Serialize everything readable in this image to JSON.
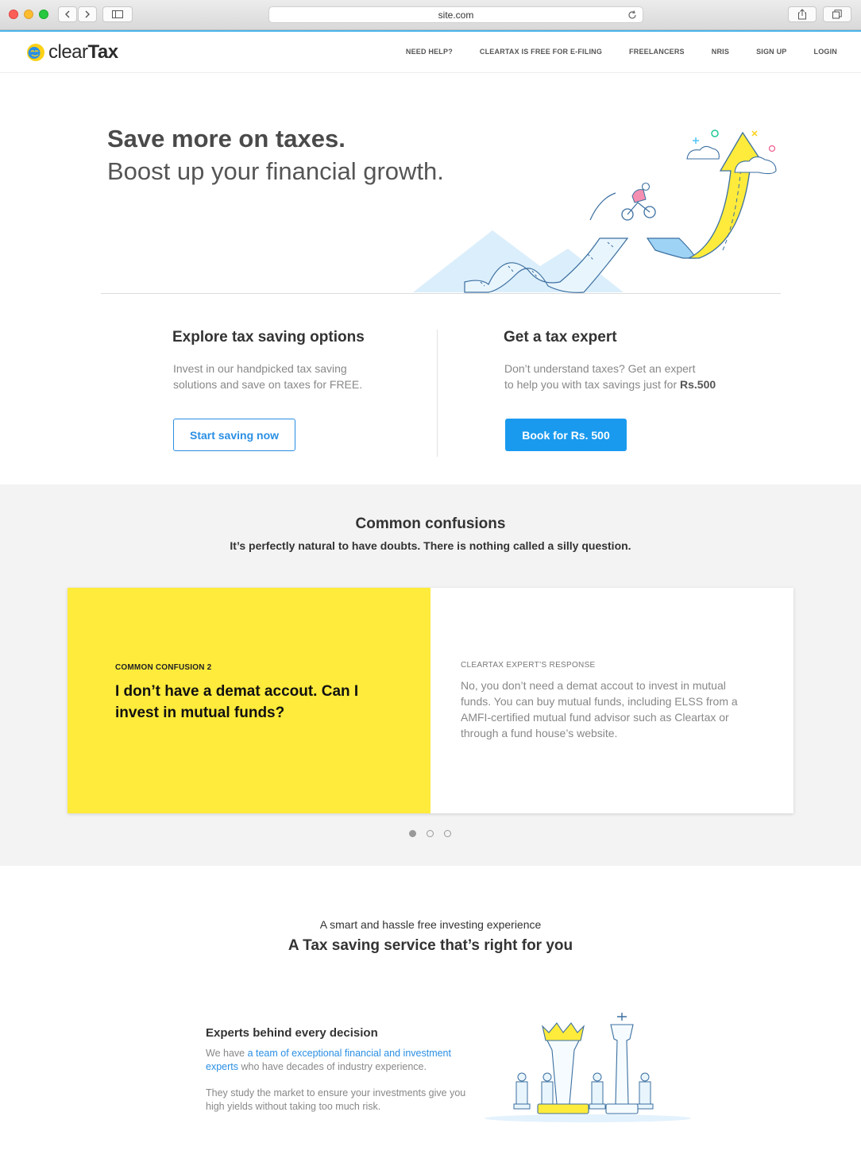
{
  "browser": {
    "url": "site.com"
  },
  "header": {
    "logo_light": "clear",
    "logo_bold": "Tax",
    "menu": [
      "NEED HELP?",
      "CLEARTAX IS FREE FOR E-FILING",
      "FREELANCERS",
      "NRIS",
      "SIGN UP",
      "LOGIN"
    ]
  },
  "hero": {
    "title": "Save more on taxes.",
    "subtitle": "Boost up your financial growth."
  },
  "explore": {
    "title": "Explore tax saving options",
    "desc_line1": "Invest in our handpicked tax saving",
    "desc_line2": "solutions and save on taxes for FREE.",
    "button": "Start saving now"
  },
  "expert": {
    "title": "Get a tax expert",
    "desc_line1": "Don’t understand taxes? Get an expert",
    "desc_line2a": "to help you with tax savings just for ",
    "desc_line2b": "Rs.500",
    "button": "Book for Rs. 500"
  },
  "confusions": {
    "title": "Common confusions",
    "subtitle": "It’s perfectly natural to have doubts. There is nothing called a silly question.",
    "card": {
      "kicker": "COMMON CONFUSION 2",
      "question": "I don’t have a demat accout. Can I invest in mutual funds?",
      "answer_kicker": "CLEARTAX EXPERT’S RESPONSE",
      "answer": "No, you don’t need a demat accout to invest in mutual funds. You can buy mutual funds, including ELSS from a AMFI-certified mutual fund advisor such as Cleartax or through a fund house’s website."
    },
    "carousel_active": 1,
    "carousel_count": 3
  },
  "service": {
    "kicker": "A smart and hassle free investing experience",
    "title": "A Tax saving service that’s right for you",
    "feature_title": "Experts behind every decision",
    "feature_p1_pre": "We have ",
    "feature_p1_link": "a team of exceptional financial and investment experts",
    "feature_p1_post": " who have decades of industry experience.",
    "feature_p2": "They study the market to ensure your investments give you high yields without taking too much risk."
  },
  "colors": {
    "accent_blue": "#1a9aef",
    "highlight_yellow": "#ffeb3b",
    "band_gray": "#f3f3f3"
  }
}
